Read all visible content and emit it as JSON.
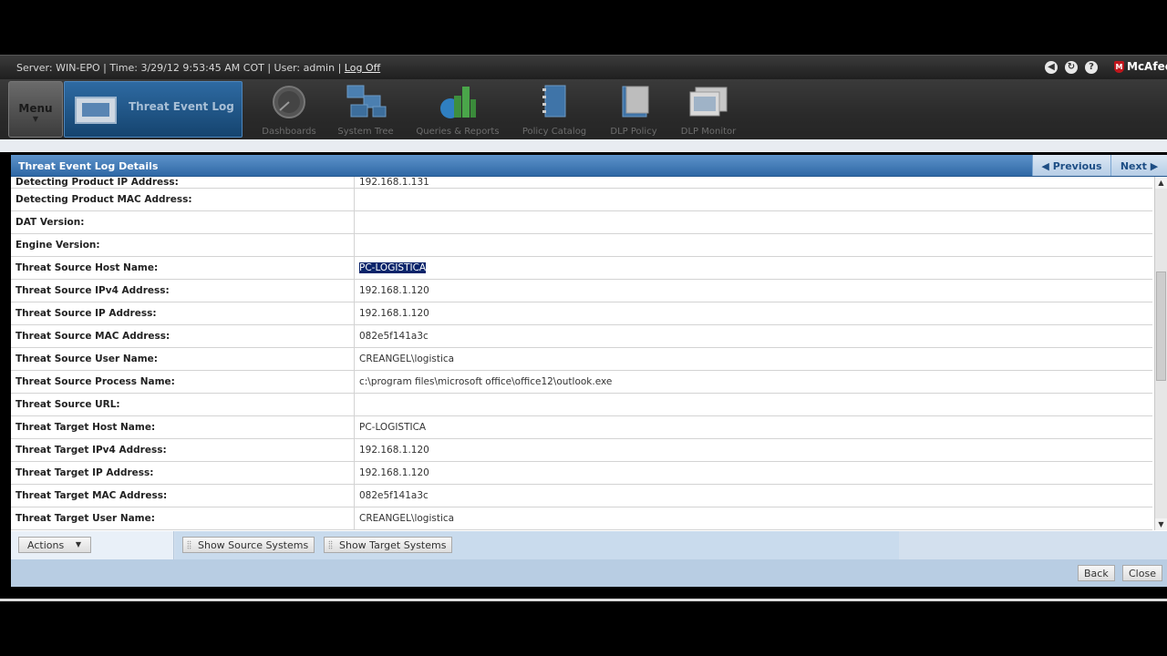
{
  "header": {
    "info_text": "Server: WIN-EPO | Time: 3/29/12 9:53:45 AM COT | User: admin |",
    "logoff_label": "Log Off",
    "brand": "McAfee",
    "icons": [
      "back-circle-icon",
      "refresh-circle-icon",
      "help-icon"
    ]
  },
  "nav": {
    "menu_label": "Menu",
    "current_tab": "Threat Event Log",
    "items": [
      {
        "label": "Dashboards",
        "icon": "dashboard-gauge-icon"
      },
      {
        "label": "System Tree",
        "icon": "system-tree-icon"
      },
      {
        "label": "Queries & Reports",
        "icon": "queries-reports-icon"
      },
      {
        "label": "Policy Catalog",
        "icon": "policy-catalog-icon"
      },
      {
        "label": "DLP Policy",
        "icon": "dlp-policy-icon"
      },
      {
        "label": "DLP Monitor",
        "icon": "dlp-monitor-icon"
      }
    ]
  },
  "panel": {
    "title": "Threat Event Log Details",
    "previous_label": "Previous",
    "next_label": "Next"
  },
  "details": [
    {
      "key": "Detecting Product IP Address:",
      "value": "192.168.1.131"
    },
    {
      "key": "Detecting Product MAC Address:",
      "value": ""
    },
    {
      "key": "DAT Version:",
      "value": ""
    },
    {
      "key": "Engine Version:",
      "value": ""
    },
    {
      "key": "Threat Source Host Name:",
      "value": "PC-LOGISTICA",
      "selected": true
    },
    {
      "key": "Threat Source IPv4 Address:",
      "value": "192.168.1.120"
    },
    {
      "key": "Threat Source IP Address:",
      "value": "192.168.1.120"
    },
    {
      "key": "Threat Source MAC Address:",
      "value": "082e5f141a3c"
    },
    {
      "key": "Threat Source User Name:",
      "value": "CREANGEL\\logistica"
    },
    {
      "key": "Threat Source Process Name:",
      "value": "c:\\program files\\microsoft office\\office12\\outlook.exe"
    },
    {
      "key": "Threat Source URL:",
      "value": ""
    },
    {
      "key": "Threat Target Host Name:",
      "value": "PC-LOGISTICA"
    },
    {
      "key": "Threat Target IPv4 Address:",
      "value": "192.168.1.120"
    },
    {
      "key": "Threat Target IP Address:",
      "value": "192.168.1.120"
    },
    {
      "key": "Threat Target MAC Address:",
      "value": "082e5f141a3c"
    },
    {
      "key": "Threat Target User Name:",
      "value": "CREANGEL\\logistica"
    }
  ],
  "footer": {
    "actions_label": "Actions",
    "show_source_label": "Show Source Systems",
    "show_target_label": "Show Target Systems",
    "back_label": "Back",
    "close_label": "Close"
  },
  "colors": {
    "panel_header": "#2f68a5",
    "selection": "#0a246a",
    "brand_red": "#c0161c"
  }
}
